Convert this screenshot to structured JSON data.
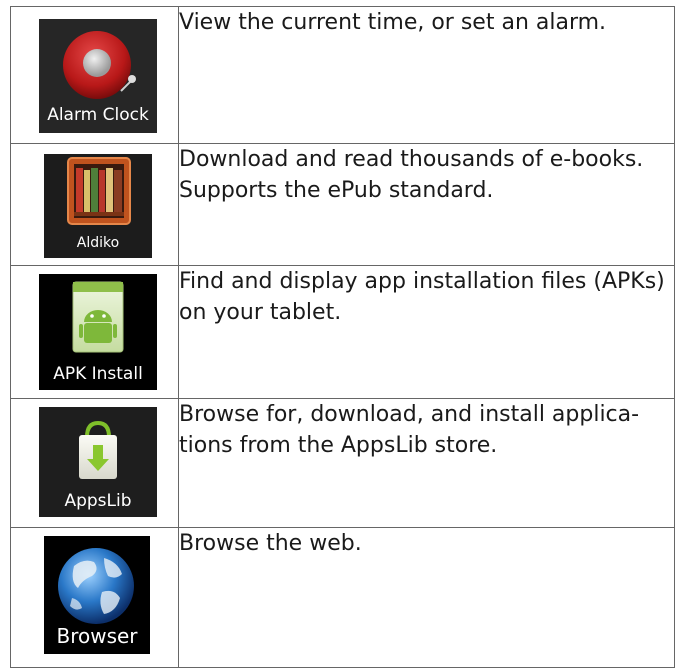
{
  "apps": [
    {
      "icon": "alarm-clock-icon",
      "label": "Alarm Clock",
      "description_lines": [
        "View the current time, or set an alarm."
      ]
    },
    {
      "icon": "aldiko-bookshelf-icon",
      "label": "Aldiko",
      "description_lines": [
        "Download and read thousands of e-books.",
        "Supports the ePub standard."
      ]
    },
    {
      "icon": "apk-install-icon",
      "label": "APK Install",
      "description_lines": [
        "Find and display app installation files (APKs)",
        "on your tablet."
      ]
    },
    {
      "icon": "appslib-shopping-bag-icon",
      "label": "AppsLib",
      "description_lines": [
        "Browse for, download, and install applica-",
        "tions from the AppsLib store."
      ]
    },
    {
      "icon": "browser-globe-icon",
      "label": "Browser",
      "description_lines": [
        "Browse the web."
      ]
    }
  ]
}
